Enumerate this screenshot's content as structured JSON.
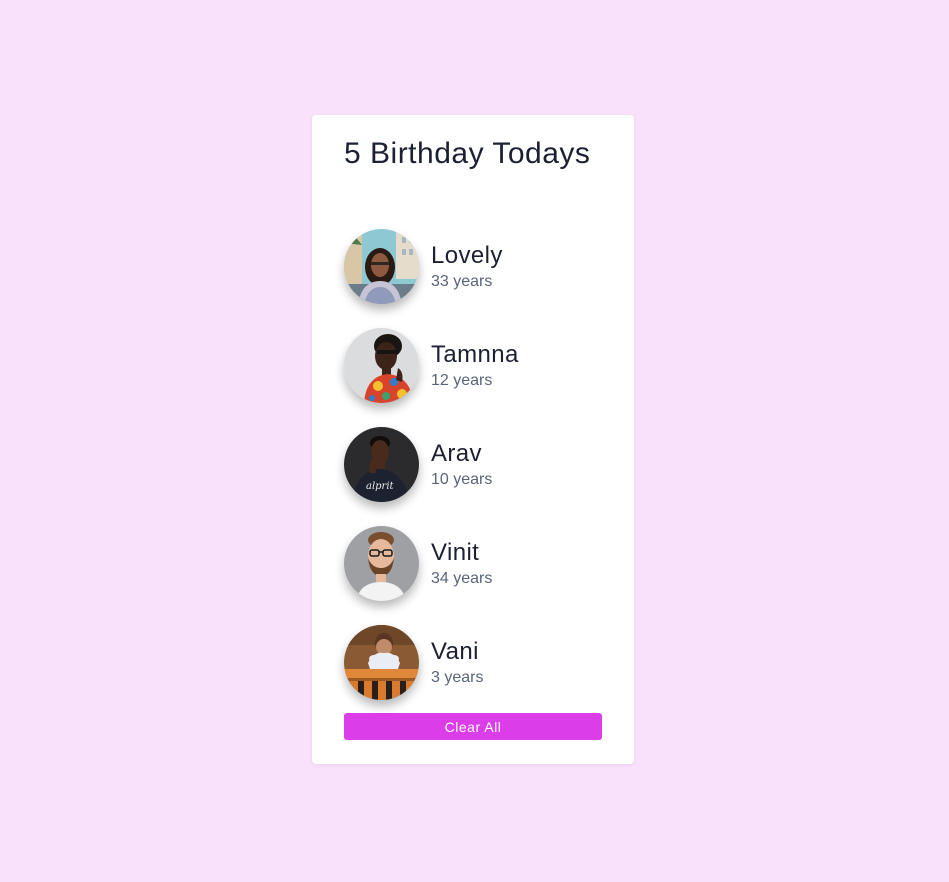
{
  "header": {
    "title": "5 Birthday Todays"
  },
  "people": [
    {
      "name": "Lovely",
      "age": "33 years",
      "avatar_icon": "woman-city-photo"
    },
    {
      "name": "Tamnna",
      "age": "12 years",
      "avatar_icon": "woman-glasses-floral-photo"
    },
    {
      "name": "Arav",
      "age": "10 years",
      "avatar_icon": "man-dark-shirt-photo"
    },
    {
      "name": "Vinit",
      "age": "34 years",
      "avatar_icon": "man-beard-glasses-photo"
    },
    {
      "name": "Vani",
      "age": "3 years",
      "avatar_icon": "child-wooden-fence-photo"
    }
  ],
  "actions": {
    "clear_label": "Clear All"
  },
  "colors": {
    "background": "#f9e1fc",
    "card": "#ffffff",
    "button": "#db3ee8",
    "text_primary": "#1b2033",
    "text_secondary": "#59637a"
  }
}
